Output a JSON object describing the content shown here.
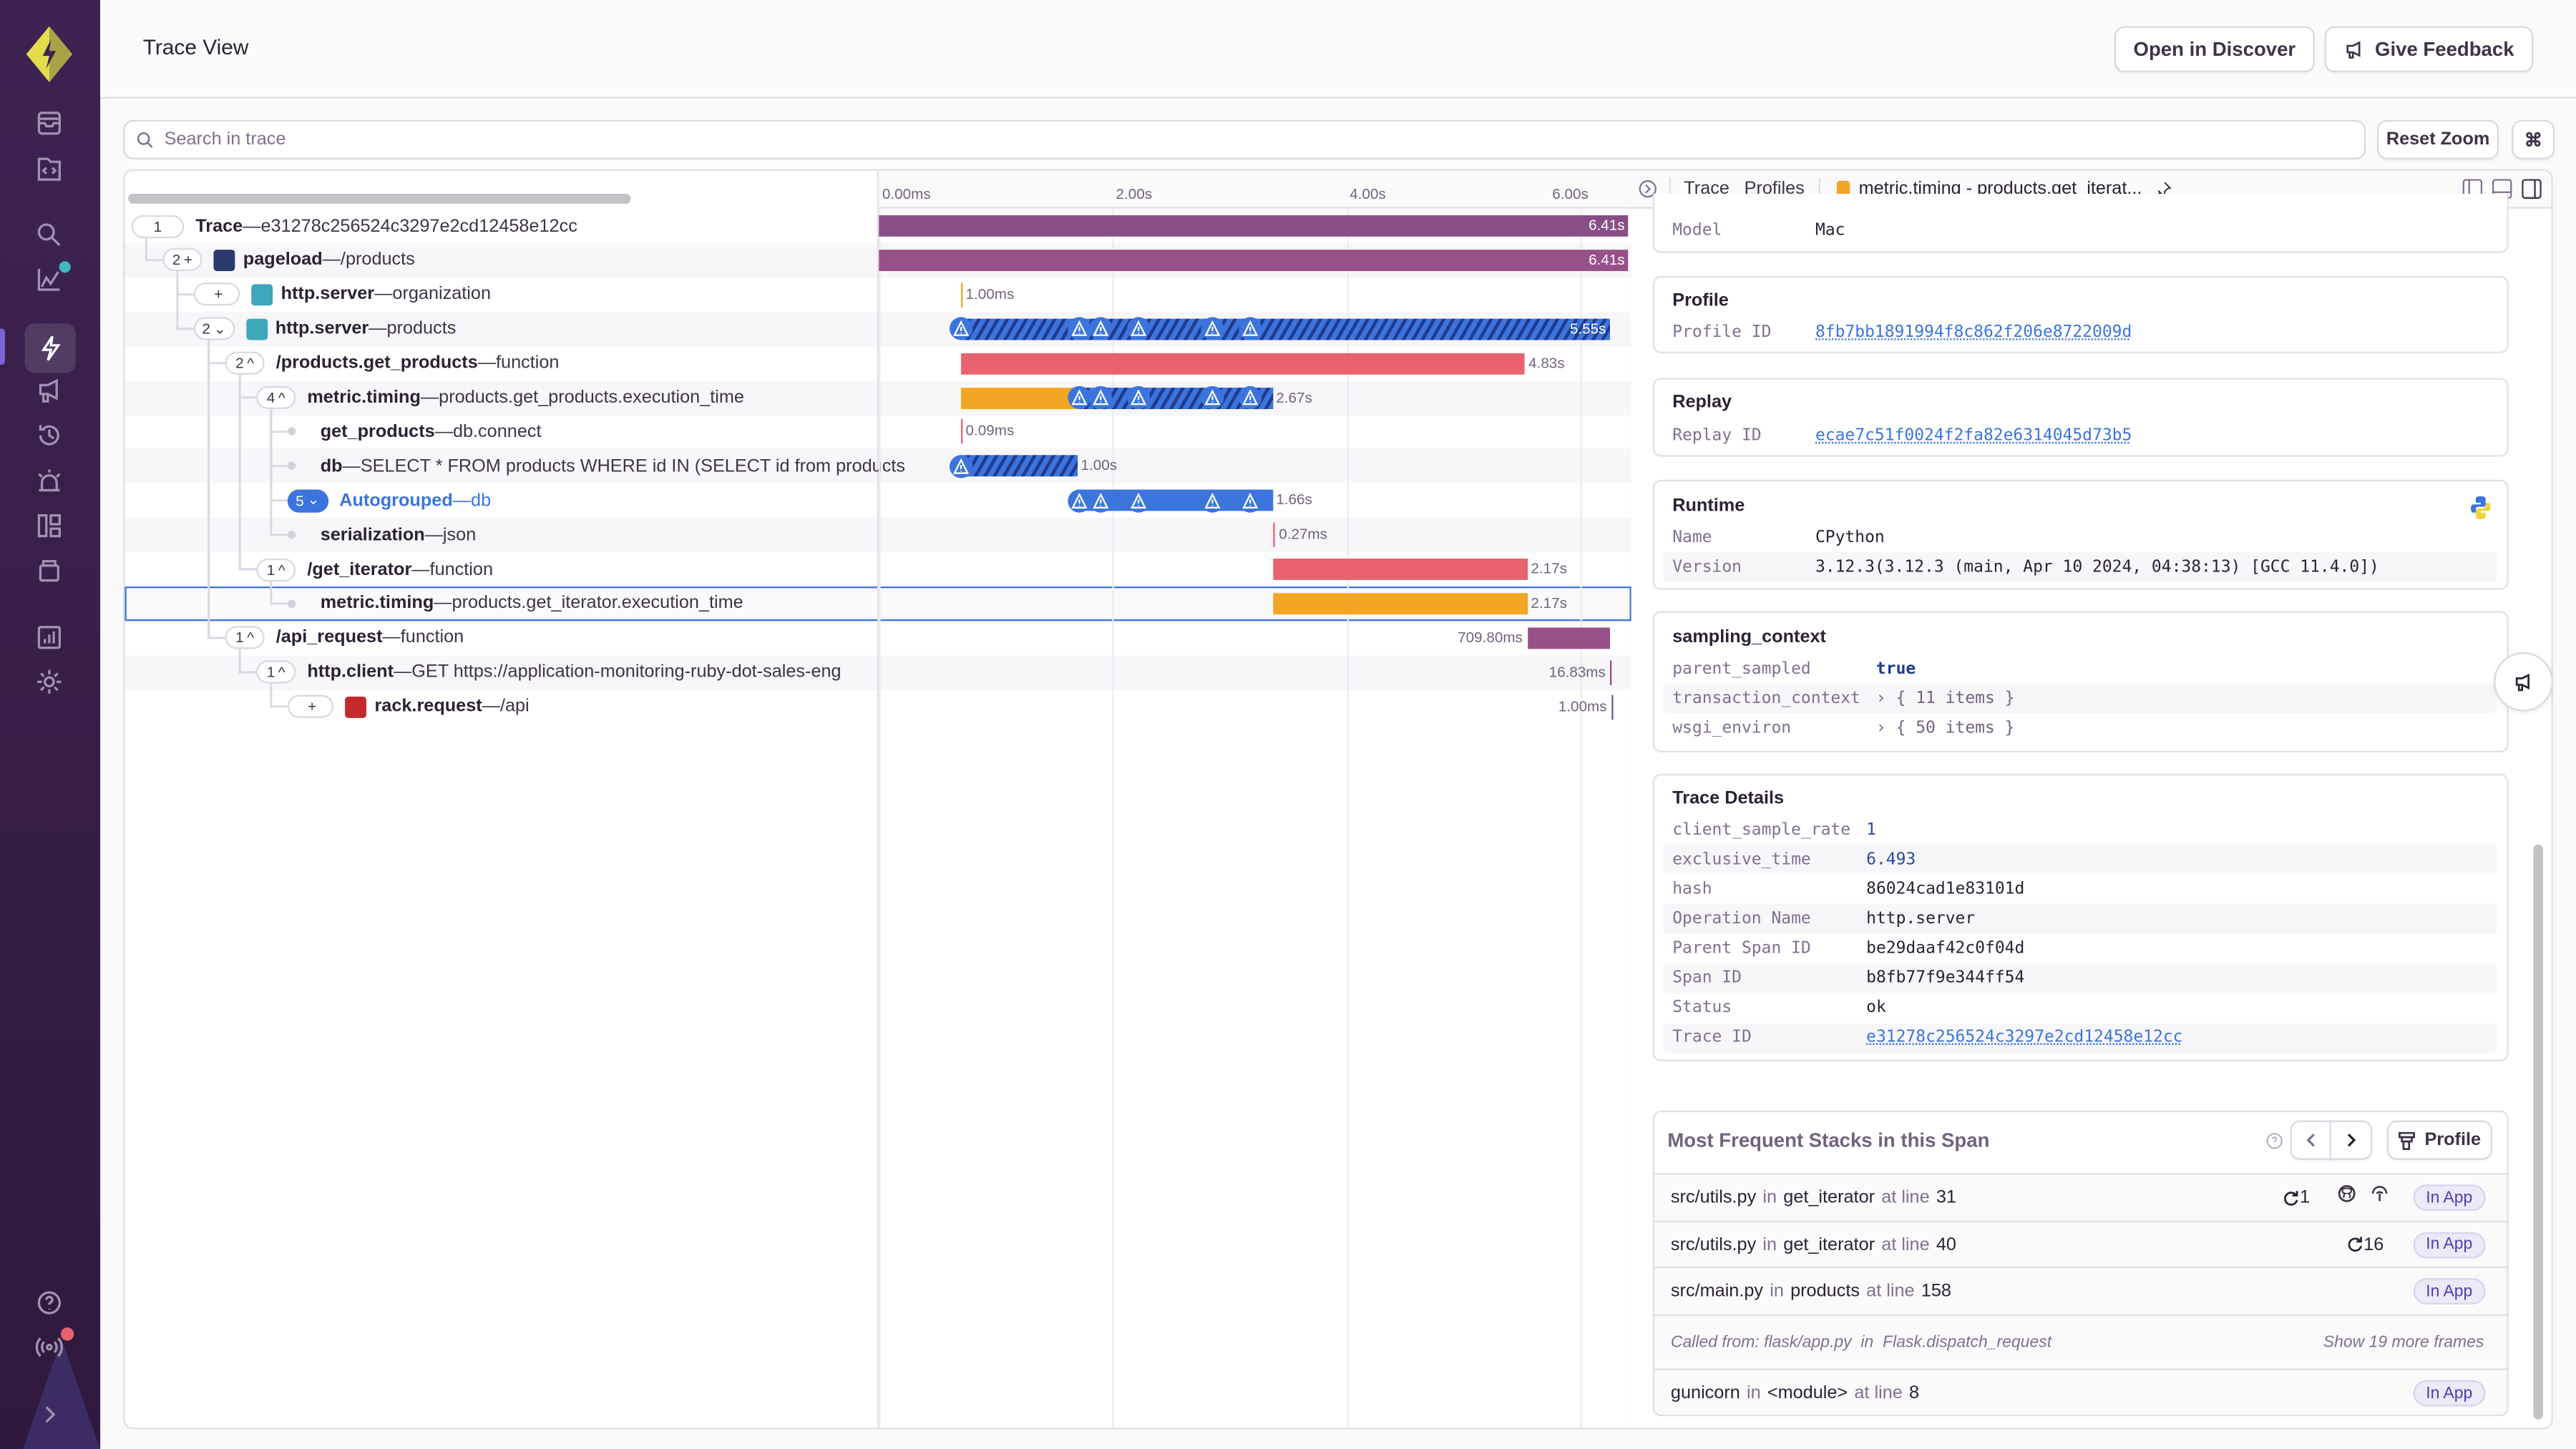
{
  "sidebar": {
    "logo": "sentry-logo-icon",
    "items": [
      {
        "name": "issues",
        "icon": "inbox-icon"
      },
      {
        "name": "projects",
        "icon": "code-folder-icon"
      },
      {
        "name": "explore",
        "icon": "search-icon"
      },
      {
        "name": "insights",
        "icon": "chart-line-icon",
        "badge": true
      },
      {
        "name": "performance",
        "icon": "lightning-icon",
        "active": true
      },
      {
        "name": "feedback",
        "icon": "megaphone-icon"
      },
      {
        "name": "releases",
        "icon": "history-icon"
      },
      {
        "name": "alerts",
        "icon": "siren-icon"
      },
      {
        "name": "dashboards",
        "icon": "dashboard-icon"
      },
      {
        "name": "releases-archive",
        "icon": "archive-icon"
      },
      {
        "name": "stats",
        "icon": "bar-chart-icon"
      },
      {
        "name": "settings",
        "icon": "gear-icon"
      }
    ],
    "bottom": [
      {
        "name": "help",
        "icon": "help-icon"
      },
      {
        "name": "broadcasts",
        "icon": "broadcast-icon",
        "badge": true
      },
      {
        "name": "collapse",
        "icon": "chevron-right-icon"
      }
    ]
  },
  "header": {
    "title": "Trace View",
    "open_in_discover": "Open in Discover",
    "give_feedback": "Give Feedback"
  },
  "search": {
    "placeholder": "Search in trace",
    "value": "",
    "reset_zoom": "Reset Zoom",
    "shortcut": "⌘"
  },
  "timeline": {
    "ticks": [
      "0.00ms",
      "2.00s",
      "4.00s",
      "6.00s"
    ],
    "max_seconds": 6.41
  },
  "tree": [
    {
      "count": "1",
      "toggle": "",
      "op": "Trace",
      "desc": "e31278c256524c3297e2cd12458e12cc",
      "depth": 0,
      "icon": null,
      "bar": {
        "start": 0,
        "dur": 6.41,
        "color": "#884f86",
        "label": "6.41s",
        "label_inside": true
      }
    },
    {
      "count": "2",
      "toggle": "+",
      "op": "pageload",
      "desc": "/products",
      "depth": 1,
      "icon": "react-icon",
      "bar": {
        "start": 0,
        "dur": 6.41,
        "color": "#985089",
        "label": "6.41s",
        "label_inside": true
      }
    },
    {
      "count": "",
      "toggle": "+",
      "op": "http.server",
      "desc": "organization",
      "depth": 2,
      "icon": "flask-icon",
      "bar": {
        "start": 0.7,
        "dur": 0.001,
        "color": "#f2a624",
        "label": "1.00ms",
        "line": true
      }
    },
    {
      "count": "2",
      "toggle": "⌄",
      "op": "http.server",
      "desc": "products",
      "depth": 2,
      "icon": "flask-icon",
      "bar": {
        "start": 0.7,
        "dur": 5.55,
        "color": "hatched",
        "label": "5.55s",
        "label_inside": true,
        "warnings": [
          0.7,
          1.71,
          1.9,
          2.22,
          2.86,
          3.18
        ]
      }
    },
    {
      "count": "2",
      "toggle": "^",
      "op": "/products.get_products",
      "desc": "function",
      "depth": 3,
      "icon": null,
      "bar": {
        "start": 0.7,
        "dur": 4.83,
        "color": "#e9626e",
        "label": "4.83s"
      }
    },
    {
      "count": "4",
      "toggle": "^",
      "op": "metric.timing",
      "desc": "products.get_products.execution_time",
      "depth": 4,
      "icon": null,
      "bar": {
        "start": 0.7,
        "dur": 2.67,
        "color": "#f2a624",
        "label": "2.67s",
        "hatch_from": 1.71,
        "warnings": [
          1.71,
          1.9,
          2.22,
          2.86,
          3.18
        ]
      }
    },
    {
      "count": null,
      "op": "get_products",
      "desc": "db.connect",
      "depth": 5,
      "icon": null,
      "bar": {
        "start": 0.7,
        "dur": 9e-05,
        "color": "#e9626e",
        "label": "0.09ms",
        "line": true
      }
    },
    {
      "count": null,
      "op": "db",
      "desc": "SELECT * FROM products WHERE id IN (SELECT id from products",
      "depth": 5,
      "icon": null,
      "bar": {
        "start": 0.7,
        "dur": 1.0,
        "color": "hatched",
        "label": "1.00s",
        "warnings": [
          0.7
        ]
      }
    },
    {
      "count": "5",
      "toggle": "⌄",
      "op": "Autogrouped",
      "desc": "db",
      "depth": 5,
      "icon": null,
      "autogrouped": true,
      "bar": {
        "start": 1.71,
        "dur": 1.66,
        "color": "#3c74dd",
        "label": "1.66s",
        "warnings": [
          1.71,
          1.9,
          2.22,
          2.86,
          3.18
        ]
      }
    },
    {
      "count": null,
      "op": "serialization",
      "desc": "json",
      "depth": 5,
      "icon": null,
      "bar": {
        "start": 3.38,
        "dur": 0.00027,
        "color": "#e9626e",
        "label": "0.27ms",
        "line": true
      }
    },
    {
      "count": "1",
      "toggle": "^",
      "op": "/get_iterator",
      "desc": "function",
      "depth": 4,
      "icon": null,
      "bar": {
        "start": 3.38,
        "dur": 2.17,
        "color": "#e9626e",
        "label": "2.17s"
      }
    },
    {
      "count": null,
      "op": "metric.timing",
      "desc": "products.get_iterator.execution_time",
      "depth": 5,
      "icon": null,
      "selected": true,
      "bar": {
        "start": 3.38,
        "dur": 2.17,
        "color": "#f2a624",
        "label": "2.17s"
      }
    },
    {
      "count": "1",
      "toggle": "^",
      "op": "/api_request",
      "desc": "function",
      "depth": 3,
      "icon": null,
      "bar": {
        "start": 5.55,
        "dur": 0.7098,
        "color": "#985089",
        "label": "709.80ms",
        "label_left": true
      }
    },
    {
      "count": "1",
      "toggle": "^",
      "op": "http.client",
      "desc": "GET https://application-monitoring-ruby-dot-sales-eng",
      "depth": 4,
      "icon": null,
      "bar": {
        "start": 6.26,
        "dur": 0.01683,
        "color": "#985089",
        "label": "16.83ms",
        "label_left": true,
        "line": true
      }
    },
    {
      "count": "",
      "toggle": "+",
      "op": "rack.request",
      "desc": "/api",
      "depth": 5,
      "icon": "ruby-icon",
      "bar": {
        "start": 6.27,
        "dur": 0.001,
        "color": "#6c5f7c",
        "label": "1.00ms",
        "label_left": true,
        "line": true
      }
    }
  ],
  "drawer": {
    "tabs": [
      "Trace",
      "Profiles"
    ],
    "active_tab": "metric.timing - products.get_iterat...",
    "active_tab_color": "#f2a624",
    "device": {
      "model_key": "Model",
      "model_value": "Mac"
    },
    "profile": {
      "title": "Profile",
      "key": "Profile ID",
      "value": "8fb7bb1891994f8c862f206e8722009d"
    },
    "replay": {
      "title": "Replay",
      "key": "Replay ID",
      "value": "ecae7c51f0024f2fa82e6314045d73b5"
    },
    "runtime": {
      "title": "Runtime",
      "name_key": "Name",
      "name_value": "CPython",
      "version_key": "Version",
      "version_value": "3.12.3(3.12.3 (main, Apr 10 2024, 04:38:13) [GCC 11.4.0])"
    },
    "sampling_context": {
      "title": "sampling_context",
      "rows": [
        {
          "key": "parent_sampled",
          "value": "true",
          "type": "bool"
        },
        {
          "key": "transaction_context",
          "value": "› { 11 items }",
          "type": "obj"
        },
        {
          "key": "wsgi_environ",
          "value": "› { 50 items }",
          "type": "obj"
        }
      ]
    },
    "trace_details": {
      "title": "Trace Details",
      "rows": [
        {
          "key": "client_sample_rate",
          "value": "1",
          "type": "num"
        },
        {
          "key": "exclusive_time",
          "value": "6.493",
          "type": "num"
        },
        {
          "key": "hash",
          "value": "86024cad1e83101d",
          "type": "str"
        },
        {
          "key": "Operation Name",
          "value": "http.server",
          "type": "str"
        },
        {
          "key": "Parent Span ID",
          "value": "be29daaf42c0f04d",
          "type": "str"
        },
        {
          "key": "Span ID",
          "value": "b8fb77f9e344ff54",
          "type": "str"
        },
        {
          "key": "Status",
          "value": "ok",
          "type": "str"
        },
        {
          "key": "Trace ID",
          "value": "e31278c256524c3297e2cd12458e12cc",
          "type": "link"
        }
      ]
    },
    "stacks": {
      "title": "Most Frequent Stacks in this Span",
      "profile_button": "Profile",
      "frames": [
        {
          "file": "src/utils.py",
          "in": "in",
          "func": "get_iterator",
          "at": "at line",
          "line": "31",
          "recursion": "1",
          "github": true,
          "codecov": true,
          "badge": "In App"
        },
        {
          "file": "src/utils.py",
          "in": "in",
          "func": "get_iterator",
          "at": "at line",
          "line": "40",
          "recursion": "16",
          "badge": "In App"
        },
        {
          "file": "src/main.py",
          "in": "in",
          "func": "products",
          "at": "at line",
          "line": "158",
          "badge": "In App"
        }
      ],
      "called_from": "Called from: flask/app.py  in  Flask.dispatch_request",
      "show_more": "Show 19 more frames",
      "last_frame": {
        "file": "gunicorn",
        "in": "in",
        "func": "<module>",
        "at": "at line",
        "line": "8",
        "badge": "In App"
      }
    }
  }
}
